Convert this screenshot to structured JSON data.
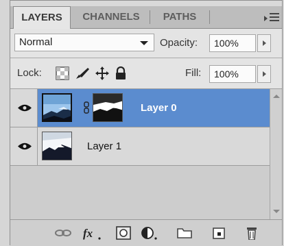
{
  "tabs": [
    {
      "label": "LAYERS",
      "active": true
    },
    {
      "label": "CHANNELS",
      "active": false
    },
    {
      "label": "PATHS",
      "active": false
    }
  ],
  "blend_mode": {
    "value": "Normal"
  },
  "opacity": {
    "label": "Opacity:",
    "value": "100%"
  },
  "lock": {
    "label": "Lock:",
    "icons": [
      "lock-transparent-pixels-icon",
      "lock-image-pixels-icon",
      "lock-position-icon",
      "lock-all-icon"
    ]
  },
  "fill": {
    "label": "Fill:",
    "value": "100%"
  },
  "layers": [
    {
      "name": "Layer 0",
      "selected": true,
      "visible": true,
      "has_mask": true
    },
    {
      "name": "Layer 1",
      "selected": false,
      "visible": true,
      "has_mask": false
    }
  ],
  "bottom_icons": [
    "link-layers-icon",
    "fx-icon",
    "add-mask-icon",
    "adjustment-layer-icon",
    "new-group-icon",
    "new-layer-icon",
    "trash-icon"
  ],
  "colors": {
    "selection": "#5b8ccf",
    "panel": "#d9d9d9"
  }
}
